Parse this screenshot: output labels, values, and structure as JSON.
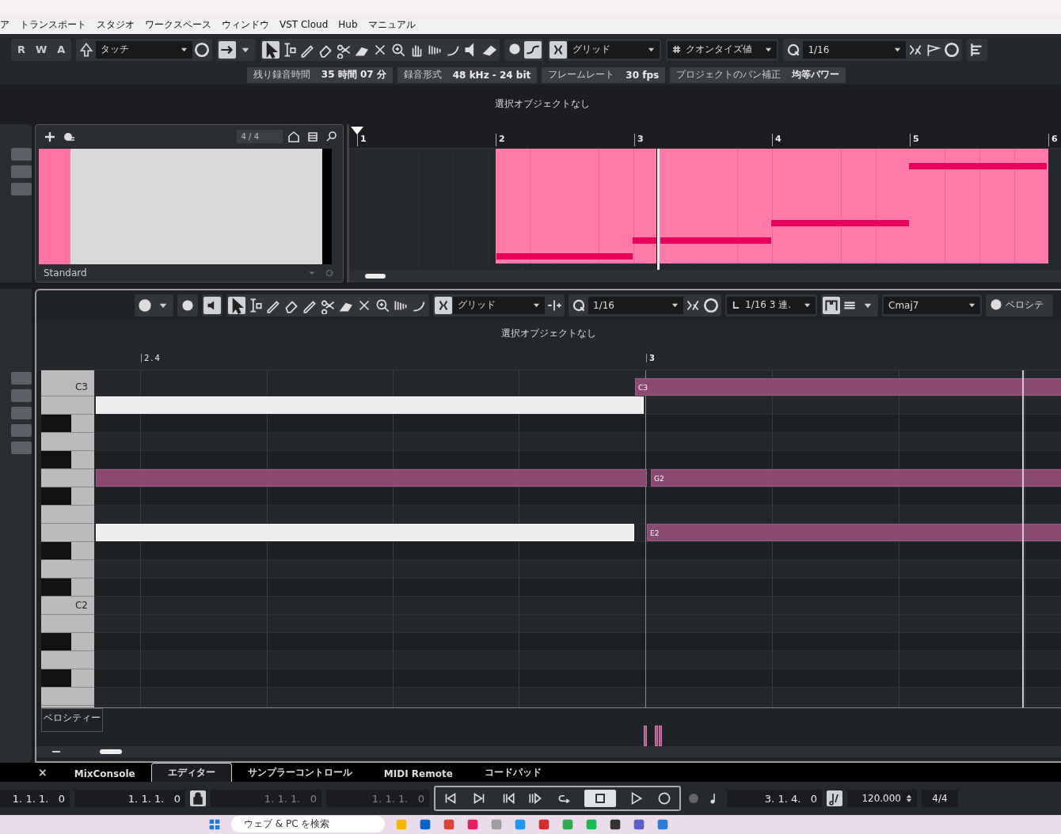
{
  "menu": [
    "ア",
    "トランスポート",
    "スタジオ",
    "ワークスペース",
    "ウィンドウ",
    "VST Cloud",
    "Hub",
    "マニュアル"
  ],
  "toolbar": {
    "automation_buttons": [
      "R",
      "W",
      "A"
    ],
    "automation_mode": "タッチ",
    "tools": [
      {
        "selected": true
      },
      {
        "selected": false
      },
      {
        "selected": false
      },
      {
        "selected": false
      },
      {
        "selected": false
      },
      {
        "selected": false
      },
      {
        "selected": false
      },
      {
        "selected": false
      },
      {
        "selected": false
      },
      {
        "selected": false
      },
      {
        "selected": false
      },
      {
        "selected": false
      },
      {
        "selected": false
      }
    ],
    "snap_type": "グリッド",
    "grid_type": "クオンタイズ値",
    "quantize": "1/16"
  },
  "status": [
    {
      "label": "残り録音時間",
      "value": "35 時間 07 分"
    },
    {
      "label": "録音形式",
      "value": "48 kHz - 24 bit"
    },
    {
      "label": "フレームレート",
      "value": "30 fps"
    },
    {
      "label": "プロジェクトのパン補正",
      "value": "均等パワー"
    }
  ],
  "info_line": "選択オブジェクトなし",
  "chord_pads": {
    "signature": "4 / 4",
    "preset": "Standard"
  },
  "arrange_ruler": [
    "1",
    "2",
    "3",
    "4",
    "5",
    "6"
  ],
  "editor": {
    "tools": [
      {
        "selected": true
      },
      {
        "selected": false
      },
      {
        "selected": false
      },
      {
        "selected": false
      },
      {
        "selected": false
      },
      {
        "selected": false
      },
      {
        "selected": false
      },
      {
        "selected": false
      },
      {
        "selected": false
      },
      {
        "selected": false
      },
      {
        "selected": false
      }
    ],
    "snap_type": "グリッド",
    "quantize": "1/16",
    "length": "1/16 3 連.",
    "chord": "Cmaj7",
    "lane": "ベロシテ",
    "info_line": "選択オブジェクトなし",
    "ruler": [
      "2.4",
      "3"
    ],
    "key_labels": [
      "C3",
      "C2"
    ],
    "notes": [
      {
        "kind": "event",
        "label": "C3"
      },
      {
        "kind": "ghost"
      },
      {
        "kind": "event"
      },
      {
        "kind": "event",
        "label": "G2"
      },
      {
        "kind": "ghost"
      },
      {
        "kind": "event",
        "label": "E2"
      }
    ],
    "velocity_label": "ベロシティー"
  },
  "close_char": "×",
  "tabs": [
    {
      "label": "MixConsole",
      "selected": false
    },
    {
      "label": "エディター",
      "selected": true
    },
    {
      "label": "サンプラーコントロール",
      "selected": false
    },
    {
      "label": "MIDI Remote",
      "selected": false
    },
    {
      "label": "コードパッド",
      "selected": false
    }
  ],
  "transport": {
    "left_locator": "1. 1. 1.   0",
    "right_locator": "1. 1. 1.   0",
    "punch_in": "1. 1. 1.   0",
    "punch_out": "1. 1. 1.   0",
    "position": "3. 1. 4.   0",
    "tempo": "120.000",
    "signature": "4/4"
  },
  "taskbar": {
    "search_placeholder": "ウェブ & PC を検索"
  }
}
